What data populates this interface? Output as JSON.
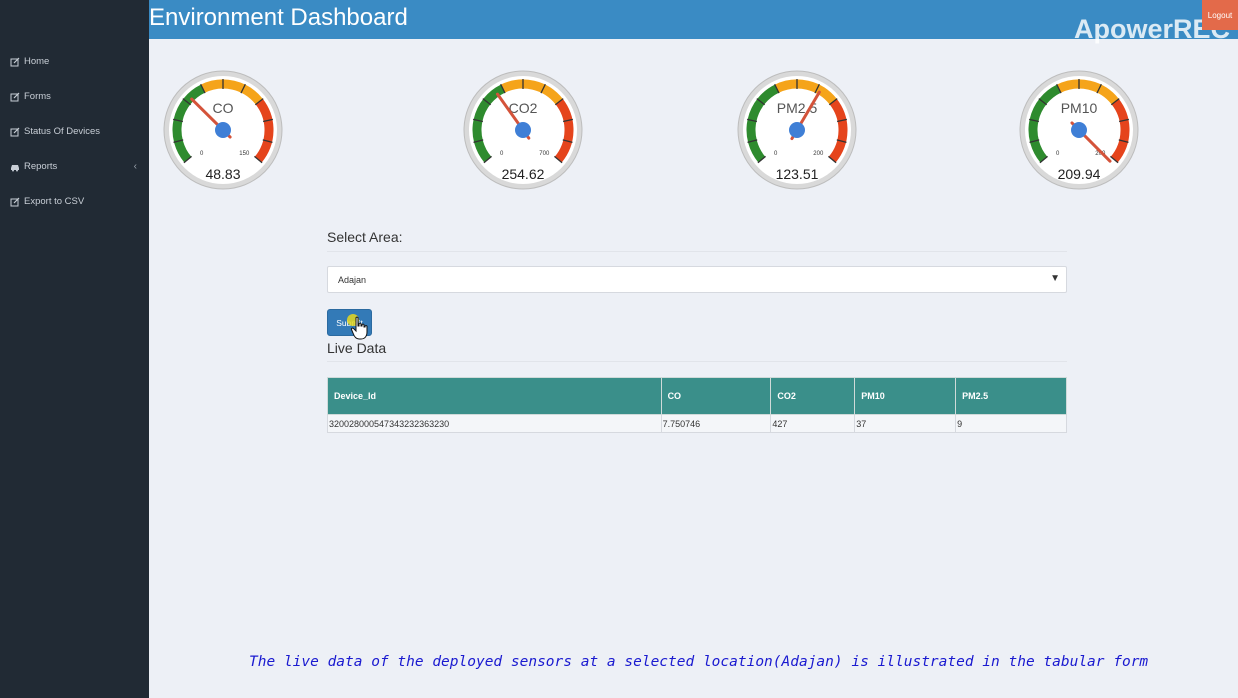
{
  "header": {
    "title": "Environment Dashboard",
    "watermark": "ApowerREC",
    "logout_label": "Logout"
  },
  "sidebar": {
    "items": [
      {
        "label": "Home",
        "icon": "edit-icon"
      },
      {
        "label": "Forms",
        "icon": "edit-icon"
      },
      {
        "label": "Status Of Devices",
        "icon": "edit-icon"
      },
      {
        "label": "Reports",
        "icon": "car-icon"
      },
      {
        "label": "Export to CSV",
        "icon": "edit-icon"
      }
    ]
  },
  "gauges": [
    {
      "label": "CO",
      "min": "0",
      "max": "150",
      "value": 48.83,
      "value_text": "48.83"
    },
    {
      "label": "CO2",
      "min": "0",
      "max": "700",
      "value": 254.62,
      "value_text": "254.62"
    },
    {
      "label": "PM2.5",
      "min": "0",
      "max": "200",
      "value": 123.51,
      "value_text": "123.51"
    },
    {
      "label": "PM10",
      "min": "0",
      "max": "200",
      "value": 209.94,
      "value_text": "209.94"
    }
  ],
  "form": {
    "select_label": "Select Area:",
    "selected_area": "Adajan",
    "submit_label": "Submit"
  },
  "live": {
    "title": "Live Data",
    "columns": [
      "Device_Id",
      "CO",
      "CO2",
      "PM10",
      "PM2.5"
    ],
    "rows": [
      [
        "320028000547343232363230",
        "7.750746",
        "427",
        "37",
        "9"
      ]
    ]
  },
  "caption": "The live data of the deployed sensors at a selected location(Adajan) is illustrated in the tabular form",
  "colors": {
    "header": "#3a8bc4",
    "sidebar": "#212a34",
    "table_header": "#3a8f8a",
    "gauge_green": "#2e8b2e",
    "gauge_orange": "#f5a41a",
    "gauge_red": "#e5441c",
    "caption": "#1a1ad0"
  }
}
